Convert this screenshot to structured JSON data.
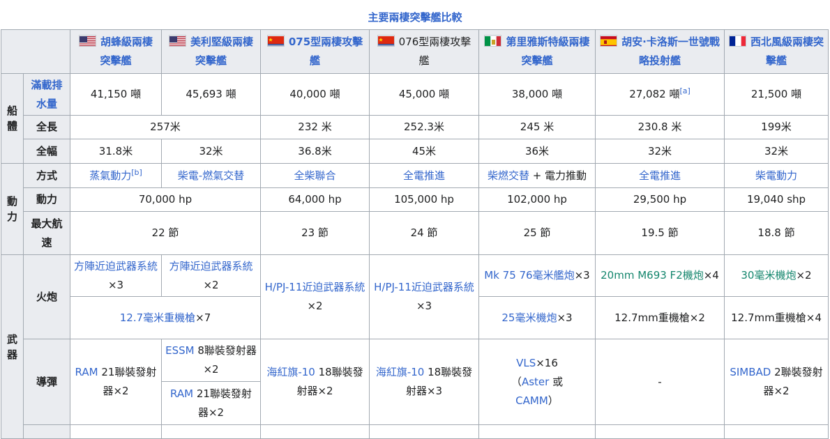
{
  "caption": "主要兩棲突擊艦比較",
  "ships": [
    {
      "name": "胡蜂級兩棲突擊艦",
      "flag": "usa"
    },
    {
      "name": "美利堅級兩棲突擊艦",
      "flag": "usa"
    },
    {
      "name": "075型兩棲攻擊艦",
      "flag": "prc"
    },
    {
      "name": "076型兩棲攻擊艦",
      "flag": "prc"
    },
    {
      "name": "第里雅斯特級兩棲突擊艦",
      "flag": "italy"
    },
    {
      "name": "胡安·卡洛斯一世號戰略投射艦",
      "flag": "spain"
    },
    {
      "name": "西北風級兩棲突擊艦",
      "flag": "france"
    }
  ],
  "hull": {
    "group": "船體",
    "disp_label": "滿載排水量",
    "disp": [
      "41,150 噸",
      "45,693 噸",
      "40,000 噸",
      "45,000 噸",
      "38,000 噸",
      "27,082 噸",
      "21,500 噸"
    ],
    "disp_ref": "[a]",
    "length_label": "全長",
    "length": [
      "257米",
      "232 米",
      "252.3米",
      "245 米",
      "230.8 米",
      "199米"
    ],
    "beam_label": "全幅",
    "beam": [
      "31.8米",
      "32米",
      "36.8米",
      "45米",
      "36米",
      "32米",
      "32米"
    ]
  },
  "power": {
    "group": "動力",
    "mode_label": "方式",
    "mode": [
      "蒸氣動力",
      "柴電-燃氣交替",
      "全柴聯合",
      "全電推進",
      "柴燃交替",
      "全電推進",
      "柴電動力"
    ],
    "mode0_ref": "[b]",
    "mode4_suffix": " + 電力推動",
    "power_label": "動力",
    "power": [
      "70,000 hp",
      "64,000 hp",
      "105,000 hp",
      "102,000 hp",
      "29,500 hp",
      "19,040 shp"
    ],
    "speed_label": "最大航速",
    "speed": [
      "22 節",
      "23 節",
      "24 節",
      "25 節",
      "19.5 節",
      "18.8 節"
    ]
  },
  "arms": {
    "group": "武器",
    "gun_label": "火炮",
    "gun1": {
      "c0": "方陣近迫武器系統",
      "c0_s": "×3",
      "c1": "方陣近迫武器系統",
      "c1_s": "×2",
      "c2": "H/PJ-11近迫武器系統",
      "c2_s": "×2",
      "c3": "H/PJ-11近迫武器系統",
      "c3_s": "×3",
      "c4": "Mk 75 76毫米艦炮",
      "c4_s": "×3",
      "c5": "20mm M693 F2機炮",
      "c5_s": "×4",
      "c6": "30毫米機炮",
      "c6_s": "×2"
    },
    "gun2": {
      "c01": "12.7毫米重機槍",
      "c01_s": "×7",
      "c4": "25毫米機炮",
      "c4_s": "×3",
      "c5": "12.7mm重機槍×2",
      "c6": "12.7mm重機槍×4"
    },
    "msl_label": "導彈",
    "msl": {
      "c0": "RAM",
      "c0_s": " 21聯裝發射器×2",
      "c1a": "ESSM",
      "c1a_s": " 8聯裝發射器×2",
      "c1b": "RAM",
      "c1b_s": " 21聯裝發射器×2",
      "c2": "海紅旗-10",
      "c2_s": " 18聯裝發射器×2",
      "c3": "海紅旗-10",
      "c3_s": " 18聯裝發射器×3",
      "c4a": "VLS",
      "c4a_s": "×16",
      "c4b_open": "（",
      "c4b": "Aster",
      "c4b_or": " 或",
      "c4c": "CAMM",
      "c4c_close": "）",
      "c5": "-",
      "c6": "SIMBAD",
      "c6_s": " 2聯裝發射器×2"
    }
  },
  "colors": {
    "link": "#3366cc",
    "green": "#14866d",
    "header_bg": "#eaecf0",
    "border": "#a2a9b1"
  }
}
